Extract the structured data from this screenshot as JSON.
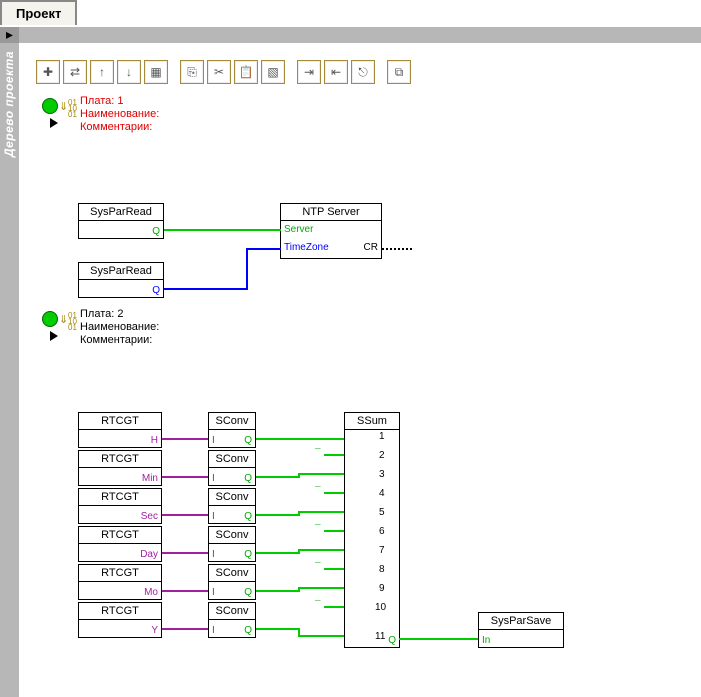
{
  "tab_title": "Проект",
  "sidebar_label": "Дерево проекта",
  "boards": [
    {
      "label": "Плата: 1",
      "name_label": "Наименование:",
      "comment_label": "Комментарии:",
      "highlight": true
    },
    {
      "label": "Плата: 2",
      "name_label": "Наименование:",
      "comment_label": "Комментарии:",
      "highlight": false
    }
  ],
  "blocks": {
    "spr1": "SysParRead",
    "spr2": "SysParRead",
    "ntp": "NTP Server",
    "ntp_p1": "Server",
    "ntp_p2": "TimeZone",
    "ntp_cr": "CR",
    "rtc": [
      "RTCGT",
      "RTCGT",
      "RTCGT",
      "RTCGT",
      "RTCGT",
      "RTCGT"
    ],
    "rtc_ports": [
      "H",
      "Min",
      "Sec",
      "Day",
      "Mo",
      "Y"
    ],
    "sconv": "SConv",
    "sc_i": "I",
    "sc_q": "Q",
    "ssum": "SSum",
    "ssum_q": "Q",
    "ssum_i": [
      "1",
      "2",
      "3",
      "4",
      "5",
      "6",
      "7",
      "8",
      "9",
      "10",
      "11"
    ],
    "sps": "SysParSave",
    "sps_in": "In"
  },
  "port_q": "Q",
  "toolbar_icons": [
    "✚",
    "⇄",
    "↑",
    "↓",
    "▦",
    "",
    "⎘",
    "✂",
    "📋",
    "▧",
    "⇥",
    "⇤",
    "⎋",
    "⧉"
  ]
}
